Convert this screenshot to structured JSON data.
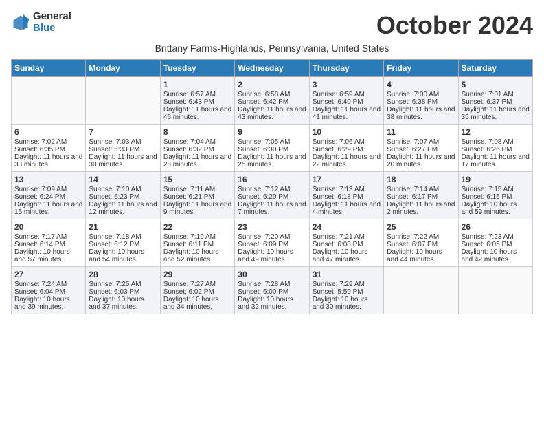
{
  "app": {
    "logo_general": "General",
    "logo_blue": "Blue"
  },
  "title": "October 2024",
  "location": "Brittany Farms-Highlands, Pennsylvania, United States",
  "days_of_week": [
    "Sunday",
    "Monday",
    "Tuesday",
    "Wednesday",
    "Thursday",
    "Friday",
    "Saturday"
  ],
  "weeks": [
    [
      {
        "day": "",
        "sunrise": "",
        "sunset": "",
        "daylight": ""
      },
      {
        "day": "",
        "sunrise": "",
        "sunset": "",
        "daylight": ""
      },
      {
        "day": "1",
        "sunrise": "Sunrise: 6:57 AM",
        "sunset": "Sunset: 6:43 PM",
        "daylight": "Daylight: 11 hours and 46 minutes."
      },
      {
        "day": "2",
        "sunrise": "Sunrise: 6:58 AM",
        "sunset": "Sunset: 6:42 PM",
        "daylight": "Daylight: 11 hours and 43 minutes."
      },
      {
        "day": "3",
        "sunrise": "Sunrise: 6:59 AM",
        "sunset": "Sunset: 6:40 PM",
        "daylight": "Daylight: 11 hours and 41 minutes."
      },
      {
        "day": "4",
        "sunrise": "Sunrise: 7:00 AM",
        "sunset": "Sunset: 6:38 PM",
        "daylight": "Daylight: 11 hours and 38 minutes."
      },
      {
        "day": "5",
        "sunrise": "Sunrise: 7:01 AM",
        "sunset": "Sunset: 6:37 PM",
        "daylight": "Daylight: 11 hours and 35 minutes."
      }
    ],
    [
      {
        "day": "6",
        "sunrise": "Sunrise: 7:02 AM",
        "sunset": "Sunset: 6:35 PM",
        "daylight": "Daylight: 11 hours and 33 minutes."
      },
      {
        "day": "7",
        "sunrise": "Sunrise: 7:03 AM",
        "sunset": "Sunset: 6:33 PM",
        "daylight": "Daylight: 11 hours and 30 minutes."
      },
      {
        "day": "8",
        "sunrise": "Sunrise: 7:04 AM",
        "sunset": "Sunset: 6:32 PM",
        "daylight": "Daylight: 11 hours and 28 minutes."
      },
      {
        "day": "9",
        "sunrise": "Sunrise: 7:05 AM",
        "sunset": "Sunset: 6:30 PM",
        "daylight": "Daylight: 11 hours and 25 minutes."
      },
      {
        "day": "10",
        "sunrise": "Sunrise: 7:06 AM",
        "sunset": "Sunset: 6:29 PM",
        "daylight": "Daylight: 11 hours and 22 minutes."
      },
      {
        "day": "11",
        "sunrise": "Sunrise: 7:07 AM",
        "sunset": "Sunset: 6:27 PM",
        "daylight": "Daylight: 11 hours and 20 minutes."
      },
      {
        "day": "12",
        "sunrise": "Sunrise: 7:08 AM",
        "sunset": "Sunset: 6:26 PM",
        "daylight": "Daylight: 11 hours and 17 minutes."
      }
    ],
    [
      {
        "day": "13",
        "sunrise": "Sunrise: 7:09 AM",
        "sunset": "Sunset: 6:24 PM",
        "daylight": "Daylight: 11 hours and 15 minutes."
      },
      {
        "day": "14",
        "sunrise": "Sunrise: 7:10 AM",
        "sunset": "Sunset: 6:23 PM",
        "daylight": "Daylight: 11 hours and 12 minutes."
      },
      {
        "day": "15",
        "sunrise": "Sunrise: 7:11 AM",
        "sunset": "Sunset: 6:21 PM",
        "daylight": "Daylight: 11 hours and 9 minutes."
      },
      {
        "day": "16",
        "sunrise": "Sunrise: 7:12 AM",
        "sunset": "Sunset: 6:20 PM",
        "daylight": "Daylight: 11 hours and 7 minutes."
      },
      {
        "day": "17",
        "sunrise": "Sunrise: 7:13 AM",
        "sunset": "Sunset: 6:18 PM",
        "daylight": "Daylight: 11 hours and 4 minutes."
      },
      {
        "day": "18",
        "sunrise": "Sunrise: 7:14 AM",
        "sunset": "Sunset: 6:17 PM",
        "daylight": "Daylight: 11 hours and 2 minutes."
      },
      {
        "day": "19",
        "sunrise": "Sunrise: 7:15 AM",
        "sunset": "Sunset: 6:15 PM",
        "daylight": "Daylight: 10 hours and 59 minutes."
      }
    ],
    [
      {
        "day": "20",
        "sunrise": "Sunrise: 7:17 AM",
        "sunset": "Sunset: 6:14 PM",
        "daylight": "Daylight: 10 hours and 57 minutes."
      },
      {
        "day": "21",
        "sunrise": "Sunrise: 7:18 AM",
        "sunset": "Sunset: 6:12 PM",
        "daylight": "Daylight: 10 hours and 54 minutes."
      },
      {
        "day": "22",
        "sunrise": "Sunrise: 7:19 AM",
        "sunset": "Sunset: 6:11 PM",
        "daylight": "Daylight: 10 hours and 52 minutes."
      },
      {
        "day": "23",
        "sunrise": "Sunrise: 7:20 AM",
        "sunset": "Sunset: 6:09 PM",
        "daylight": "Daylight: 10 hours and 49 minutes."
      },
      {
        "day": "24",
        "sunrise": "Sunrise: 7:21 AM",
        "sunset": "Sunset: 6:08 PM",
        "daylight": "Daylight: 10 hours and 47 minutes."
      },
      {
        "day": "25",
        "sunrise": "Sunrise: 7:22 AM",
        "sunset": "Sunset: 6:07 PM",
        "daylight": "Daylight: 10 hours and 44 minutes."
      },
      {
        "day": "26",
        "sunrise": "Sunrise: 7:23 AM",
        "sunset": "Sunset: 6:05 PM",
        "daylight": "Daylight: 10 hours and 42 minutes."
      }
    ],
    [
      {
        "day": "27",
        "sunrise": "Sunrise: 7:24 AM",
        "sunset": "Sunset: 6:04 PM",
        "daylight": "Daylight: 10 hours and 39 minutes."
      },
      {
        "day": "28",
        "sunrise": "Sunrise: 7:25 AM",
        "sunset": "Sunset: 6:03 PM",
        "daylight": "Daylight: 10 hours and 37 minutes."
      },
      {
        "day": "29",
        "sunrise": "Sunrise: 7:27 AM",
        "sunset": "Sunset: 6:02 PM",
        "daylight": "Daylight: 10 hours and 34 minutes."
      },
      {
        "day": "30",
        "sunrise": "Sunrise: 7:28 AM",
        "sunset": "Sunset: 6:00 PM",
        "daylight": "Daylight: 10 hours and 32 minutes."
      },
      {
        "day": "31",
        "sunrise": "Sunrise: 7:29 AM",
        "sunset": "Sunset: 5:59 PM",
        "daylight": "Daylight: 10 hours and 30 minutes."
      },
      {
        "day": "",
        "sunrise": "",
        "sunset": "",
        "daylight": ""
      },
      {
        "day": "",
        "sunrise": "",
        "sunset": "",
        "daylight": ""
      }
    ]
  ]
}
